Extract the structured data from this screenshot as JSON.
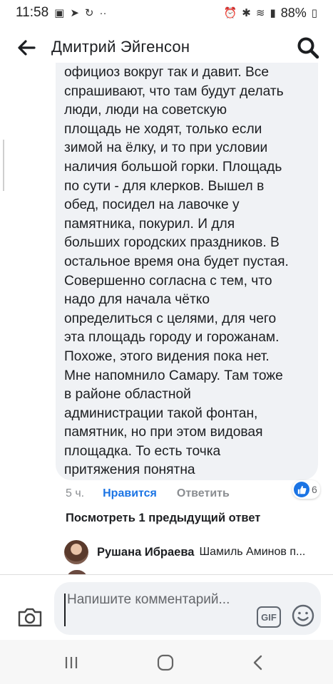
{
  "status_bar": {
    "time": "11:58",
    "battery": "88%"
  },
  "header": {
    "title": "Дмитрий Эйгенсон",
    "back_icon": "arrow-left-icon",
    "search_icon": "search-icon"
  },
  "comment": {
    "lines": [
      "официоз вокруг так и давит. Все",
      "спрашивают, что там будут делать",
      "люди, люди на советскую",
      "площадь не ходят, только если",
      "зимой на ёлку, и то при условии",
      "наличия большой горки. Площадь",
      "по сути - для клерков. Вышел в",
      "обед, посидел на лавочке у",
      "памятника, покурил. И для",
      "больших городских праздников. В",
      "остальное время она будет пустая.",
      "Совершенно согласна с тем, что",
      "надо для начала чётко",
      "определиться с целями, для чего",
      "эта площадь городу и горожанам.",
      "Похоже, этого видения пока нет.",
      "Мне напомнило Самару. Там тоже",
      "в районе областной",
      "администрации такой фонтан,",
      "памятник, но при этом видовая",
      "площадка. То есть точка",
      "притяжения понятна"
    ],
    "time": "5 ч.",
    "like_label": "Нравится",
    "reply_label": "Ответить",
    "reaction_count": "6",
    "reaction_icon": "like-icon"
  },
  "previous_replies": "Посмотреть 1 предыдущий ответ",
  "reply": {
    "author": "Рушана Ибраева",
    "text": "Шамиль Аминов п..."
  },
  "composer": {
    "placeholder": "Напишите комментарий...",
    "gif_label": "GIF"
  },
  "colors": {
    "accent": "#1b74e4",
    "bubble": "#f0f2f5",
    "text": "#1c1e21",
    "muted": "#65676b"
  }
}
